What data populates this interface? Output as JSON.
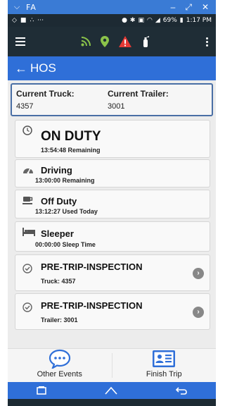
{
  "window": {
    "title": "FA"
  },
  "status_bar": {
    "battery": "69%",
    "time": "1:17 PM"
  },
  "header": {
    "title": "HOS"
  },
  "truck_info": {
    "truck_label": "Current Truck:",
    "truck_value": "4357",
    "trailer_label": "Current Trailer:",
    "trailer_value": "3001"
  },
  "statuses": [
    {
      "title": "ON DUTY",
      "subtitle": "13:54:48 Remaining",
      "icon": "clock-icon"
    },
    {
      "title": "Driving",
      "subtitle": "13:00:00 Remaining",
      "icon": "speedometer-icon"
    },
    {
      "title": "Off Duty",
      "subtitle": "13:12:27 Used Today",
      "icon": "coffee-cup-icon"
    },
    {
      "title": "Sleeper",
      "subtitle": "00:00:00 Sleep Time",
      "icon": "bed-icon"
    }
  ],
  "inspections": [
    {
      "title": "PRE-TRIP-INSPECTION",
      "subtitle": "Truck: 4357",
      "icon": "check-circle-icon"
    },
    {
      "title": "PRE-TRIP-INSPECTION",
      "subtitle": "Trailer: 3001",
      "icon": "check-circle-icon"
    }
  ],
  "bottom_nav": {
    "other_events": "Other Events",
    "finish_trip": "Finish Trip"
  },
  "colors": {
    "primary": "#2f6fd8",
    "dark": "#1d2a33",
    "alert": "#e53935",
    "gps": "#8bc34a"
  }
}
